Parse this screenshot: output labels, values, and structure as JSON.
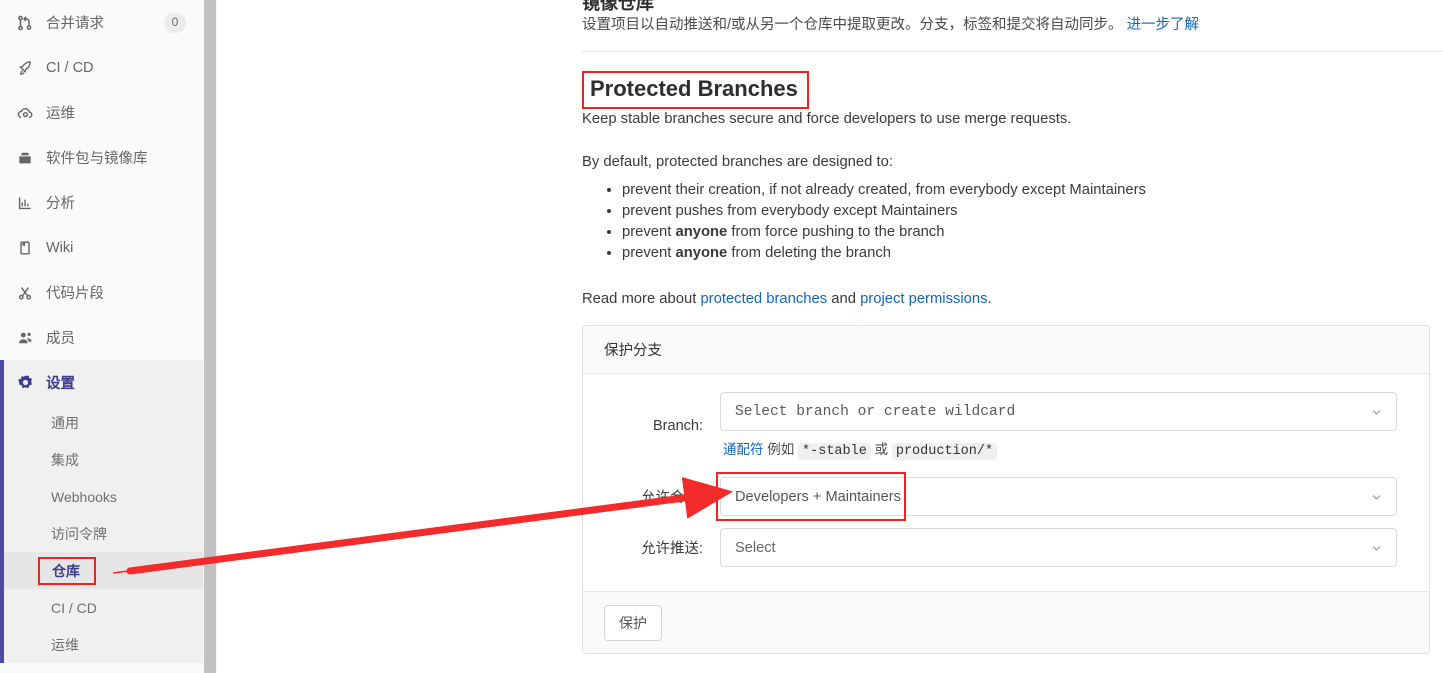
{
  "sidebar": {
    "items": [
      {
        "label": "合并请求",
        "icon": "merge-request-icon",
        "badge": "0"
      },
      {
        "label": "CI / CD",
        "icon": "rocket-icon",
        "badge": ""
      },
      {
        "label": "运维",
        "icon": "cloud-gear-icon",
        "badge": ""
      },
      {
        "label": "软件包与镜像库",
        "icon": "package-icon",
        "badge": ""
      },
      {
        "label": "分析",
        "icon": "chart-bar-icon",
        "badge": ""
      },
      {
        "label": "Wiki",
        "icon": "book-icon",
        "badge": ""
      },
      {
        "label": "代码片段",
        "icon": "scissors-icon",
        "badge": ""
      },
      {
        "label": "成员",
        "icon": "users-icon",
        "badge": ""
      }
    ],
    "settings": {
      "label": "设置",
      "icon": "gear-icon",
      "sub_items": [
        {
          "label": "通用",
          "active": false
        },
        {
          "label": "集成",
          "active": false
        },
        {
          "label": "Webhooks",
          "active": false
        },
        {
          "label": "访问令牌",
          "active": false
        },
        {
          "label": "仓库",
          "active": true
        },
        {
          "label": "CI / CD",
          "active": false
        },
        {
          "label": "运维",
          "active": false
        }
      ]
    }
  },
  "main": {
    "mirroring_title": "镜像仓库",
    "mirroring_desc": "设置项目以自动推送和/或从另一个仓库中提取更改。分支，标签和提交将自动同步。",
    "mirroring_link": "进一步了解",
    "protected_heading": "Protected Branches",
    "keep_stable": "Keep stable branches secure and force developers to use merge requests.",
    "by_default": "By default, protected branches are designed to:",
    "bullets": [
      {
        "pre": "prevent their creation, if not already created, from everybody except Maintainers",
        "bold": "",
        "post": ""
      },
      {
        "pre": "prevent pushes from everybody except Maintainers",
        "bold": "",
        "post": ""
      },
      {
        "pre": "prevent ",
        "bold": "anyone",
        "post": " from force pushing to the branch"
      },
      {
        "pre": "prevent ",
        "bold": "anyone",
        "post": " from deleting the branch"
      }
    ],
    "read_more_pre": "Read more about ",
    "read_more_link1": "protected branches",
    "read_more_mid": " and ",
    "read_more_link2": "project permissions",
    "read_more_post": "."
  },
  "panel": {
    "header": "保护分支",
    "branch_label": "Branch:",
    "branch_value": "Select branch or create wildcard",
    "helper_link": "通配符",
    "helper_mid1": " 例如 ",
    "helper_code1": "*-stable",
    "helper_mid2": " 或 ",
    "helper_code2": "production/*",
    "merge_label": "允许合并:",
    "merge_value": "Developers + Maintainers",
    "push_label": "允许推送:",
    "push_value": "Select",
    "submit_label": "保护"
  },
  "colors": {
    "accent_purple": "#3d3d8f",
    "link_blue": "#1068bf",
    "annotation_red": "#ef2222",
    "sidebar_bg": "#fafafa",
    "active_sub_bg": "#e6e6e6"
  }
}
